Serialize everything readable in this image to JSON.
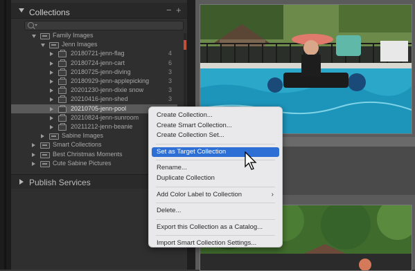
{
  "collections_panel": {
    "title": "Collections",
    "add_label": "+",
    "remove_label": "−",
    "search_placeholder": "",
    "tree": [
      {
        "label": "Family Images",
        "type": "set",
        "indent": 0,
        "expanded": true
      },
      {
        "label": "Jenn Images",
        "type": "set",
        "indent": 1,
        "expanded": true
      },
      {
        "label": "20180721-jenn-flag",
        "type": "collection",
        "indent": 2,
        "count": "4"
      },
      {
        "label": "20180724-jenn-cart",
        "type": "collection",
        "indent": 2,
        "count": "6"
      },
      {
        "label": "20180725-jenn-diving",
        "type": "collection",
        "indent": 2,
        "count": "3"
      },
      {
        "label": "20180929-jenn-applepicking",
        "type": "collection",
        "indent": 2,
        "count": "3"
      },
      {
        "label": "20201230-jenn-dixie snow",
        "type": "collection",
        "indent": 2,
        "count": "3"
      },
      {
        "label": "20210416-jenn-shed",
        "type": "collection",
        "indent": 2,
        "count": "3"
      },
      {
        "label": "20210705-jenn-pool",
        "type": "collection",
        "indent": 2,
        "count": "",
        "selected": true
      },
      {
        "label": "20210824-jenn-sunroom",
        "type": "collection",
        "indent": 2,
        "count": ""
      },
      {
        "label": "20211212-jenn-beanie",
        "type": "collection",
        "indent": 2,
        "count": ""
      },
      {
        "label": "Sabine Images",
        "type": "set",
        "indent": 1,
        "expanded": false
      },
      {
        "label": "Smart Collections",
        "type": "set",
        "indent": 0,
        "expanded": false
      },
      {
        "label": "Best Christmas Moments",
        "type": "set",
        "indent": 0,
        "expanded": false
      },
      {
        "label": "Cute Sabine Pictures",
        "type": "set",
        "indent": 0,
        "expanded": false
      }
    ]
  },
  "publish_services": {
    "title": "Publish Services"
  },
  "context_menu": {
    "items": [
      {
        "label": "Create Collection...",
        "highlighted": false
      },
      {
        "label": "Create Smart Collection...",
        "highlighted": false
      },
      {
        "label": "Create Collection Set...",
        "highlighted": false
      },
      {
        "separator": true
      },
      {
        "label": "Set as Target Collection",
        "highlighted": true
      },
      {
        "separator": true
      },
      {
        "label": "Rename...",
        "highlighted": false
      },
      {
        "label": "Duplicate Collection",
        "highlighted": false
      },
      {
        "separator": true
      },
      {
        "label": "Add Color Label to Collection",
        "highlighted": false,
        "submenu": true
      },
      {
        "separator": true
      },
      {
        "label": "Delete...",
        "highlighted": false
      },
      {
        "separator": true
      },
      {
        "label": "Export this Collection as a Catalog...",
        "highlighted": false
      },
      {
        "separator": true
      },
      {
        "label": "Import Smart Collection Settings...",
        "highlighted": false
      }
    ],
    "submenu_arrow": "›"
  },
  "colors": {
    "highlight": "#2d6fd5",
    "panel_bg": "#2f2f2f",
    "menu_bg": "#e9e9eb"
  }
}
